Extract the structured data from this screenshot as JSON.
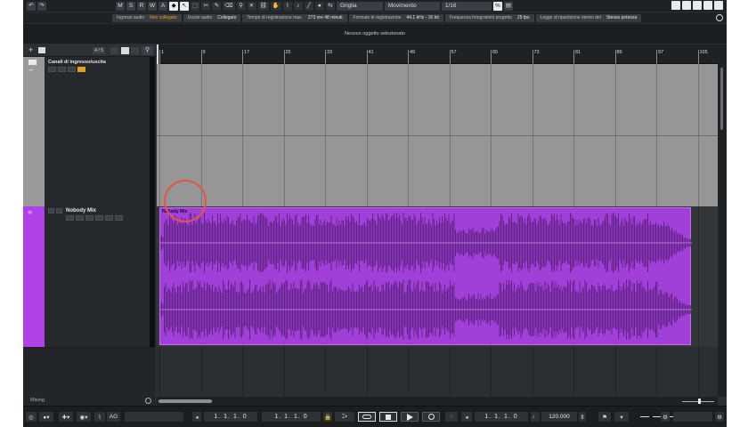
{
  "toolbar": {
    "undo": "↶",
    "redo": "↷",
    "m_button": "M",
    "s_button": "S",
    "r_button": "R",
    "w_button": "W",
    "a_button": "A",
    "snap_type": "Griglia",
    "grid_type": "Movimento",
    "quantize": "1/16"
  },
  "status": {
    "input_label": "Ingressi audio",
    "input_value": "Non collegato",
    "output_label": "Uscite audio",
    "output_value": "Collegato",
    "rectime_label": "Tempo di registrazione max.",
    "rectime_value": "273 ore 48 minuti",
    "format_label": "Formato di registrazione",
    "format_value": "44.1 kHz - 16 bit",
    "fps_label": "Frequenza fotogrammi progetto",
    "fps_value": "25 fps",
    "pan_label": "Legge di ripartizione stereo del",
    "pan_value": "Stesso potenza"
  },
  "info_line": "Nessun oggetto selezionato",
  "tracklist": {
    "count": "4 / 5",
    "folder_track_name": "Canali di ingresso/uscita",
    "audio_track_name": "Nobody Mix",
    "footer_mode": "Mixing"
  },
  "ruler": {
    "bars": [
      "1",
      "9",
      "17",
      "25",
      "33",
      "41",
      "49",
      "57",
      "65",
      "73",
      "81",
      "89",
      "97",
      "105"
    ]
  },
  "event": {
    "label": "Nobody Mix",
    "color": "#a040d8"
  },
  "transport": {
    "ag_label": "AG",
    "left_locator": "1. 1. 1.   0",
    "right_locator": "1. 1. 1.   0",
    "primary_time": "1. 1. 1.   0",
    "tempo": "120.000"
  },
  "colors": {
    "folder_track": "#9a9a9a",
    "audio_track": "#b040e8",
    "warning_text": "#e3a21a",
    "annotation": "#e2554a"
  }
}
